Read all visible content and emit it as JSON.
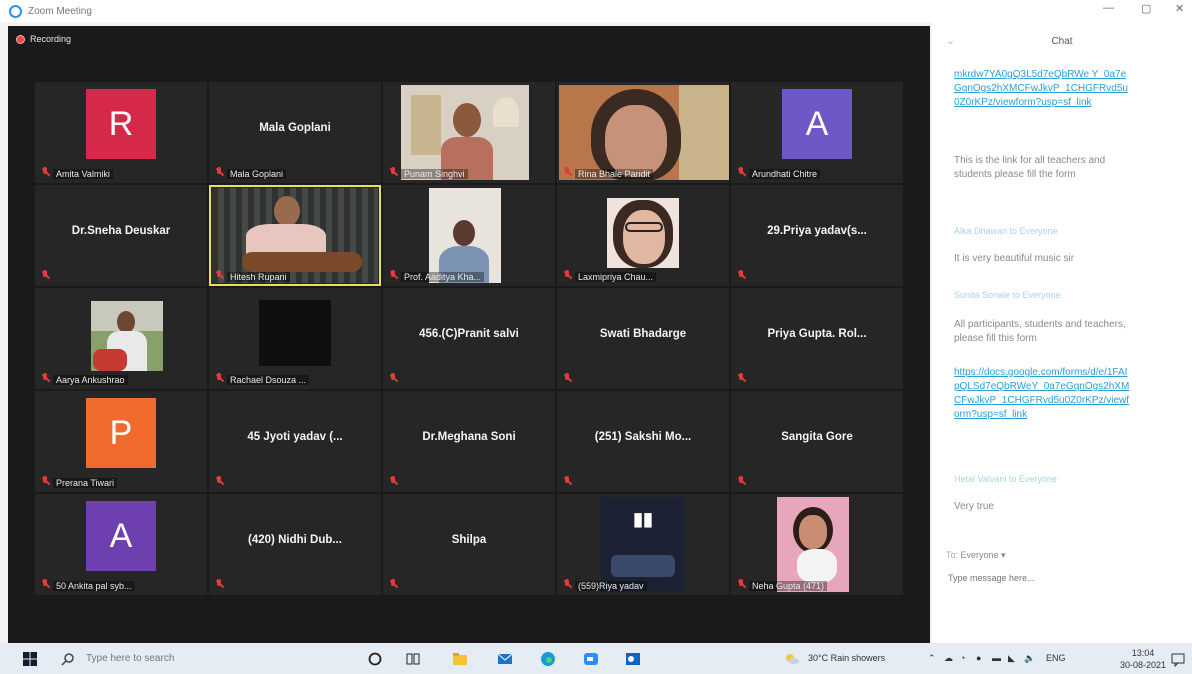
{
  "window": {
    "title": "Zoom Meeting"
  },
  "recording": {
    "label": "Recording"
  },
  "participants": [
    {
      "name": "Amita Valmiki",
      "type": "avatar",
      "initial": "R",
      "color": "#d6294a"
    },
    {
      "name": "Mala Goplani",
      "type": "name",
      "big": "Mala Goplani"
    },
    {
      "name": "Punam Singhvi",
      "type": "video",
      "scene": "room-woman"
    },
    {
      "name": "Rina Bhale Pandit",
      "type": "video",
      "scene": "closeup-woman"
    },
    {
      "name": "Arundhati Chitre",
      "type": "avatar",
      "initial": "A",
      "color": "#6e57c7"
    },
    {
      "name": "",
      "type": "name",
      "big": "Dr.Sneha Deuskar"
    },
    {
      "name": "Hitesh Rupani",
      "type": "video",
      "scene": "guitar",
      "active": true
    },
    {
      "name": "Prof. Aaditya Kha...",
      "type": "video",
      "scene": "small-man"
    },
    {
      "name": "Laxmipriya Chau...",
      "type": "video",
      "scene": "glasses-woman"
    },
    {
      "name": "",
      "type": "name",
      "big": "29.Priya yadav(s..."
    },
    {
      "name": "Aarya Ankushrao",
      "type": "video",
      "scene": "outdoor-man"
    },
    {
      "name": "Rachael Dsouza ...",
      "type": "video",
      "scene": "dark"
    },
    {
      "name": "",
      "type": "name",
      "big": "456.(C)Pranit salvi"
    },
    {
      "name": "",
      "type": "name",
      "big": "Swati Bhadarge"
    },
    {
      "name": "",
      "type": "name",
      "big": "Priya Gupta. Rol..."
    },
    {
      "name": "Prerana Tiwari",
      "type": "avatar",
      "initial": "P",
      "color": "#ef6a2c"
    },
    {
      "name": "",
      "type": "name",
      "big": "45 Jyoti yadav (..."
    },
    {
      "name": "",
      "type": "name",
      "big": "Dr.Meghana Soni"
    },
    {
      "name": "",
      "type": "name",
      "big": "(251) Sakshi Mo..."
    },
    {
      "name": "",
      "type": "name",
      "big": "Sangita Gore"
    },
    {
      "name": "50 Ankita pal syb...",
      "type": "avatar",
      "initial": "A",
      "color": "#6e3fae"
    },
    {
      "name": "",
      "type": "name",
      "big": "(420) Nidhi Dub..."
    },
    {
      "name": "",
      "type": "name",
      "big": "Shilpa"
    },
    {
      "name": "(559)Riya yadav",
      "type": "video",
      "scene": "bts"
    },
    {
      "name": "Neha Gupta (471)",
      "type": "video",
      "scene": "pink-woman"
    }
  ],
  "chat": {
    "title": "Chat",
    "messages": [
      {
        "kind": "link",
        "text": "mkrdw7YA0gQ3L5d7eQbRWe Y_0a7eGqnOgs2hXMCFwJkvP_1CHGFRvd5u0Z0rKPz/viewform?usp=sf_link"
      },
      {
        "kind": "text",
        "text": "This is the link for all teachers and students please fill the form"
      },
      {
        "kind": "sender",
        "text": "Alka Dhawan  to  Everyone"
      },
      {
        "kind": "text",
        "text": "It is very beautiful music sir"
      },
      {
        "kind": "sender",
        "text": "Sunita Sonale  to  Everyone"
      },
      {
        "kind": "text",
        "text": "All participants, students and teachers, please fill this form"
      },
      {
        "kind": "link",
        "text": "https://docs.google.com/forms/d/e/1FAIpQLSd7eQbRWeY_0a7eGqnOgs2hXMCFwJkvP_1CHGFRvd5u0Z0rKPz/viewform?usp=sf_link"
      },
      {
        "kind": "sender",
        "text": "Hetal Valvani  to  Everyone"
      },
      {
        "kind": "text",
        "text": "Very true"
      }
    ],
    "to_label": "Everyone ▾",
    "input_placeholder": "Type message here..."
  },
  "taskbar": {
    "search_placeholder": "Type here to search",
    "weather": "30°C  Rain showers",
    "lang": "ENG",
    "time": "13:04",
    "date": "30-08-2021"
  }
}
